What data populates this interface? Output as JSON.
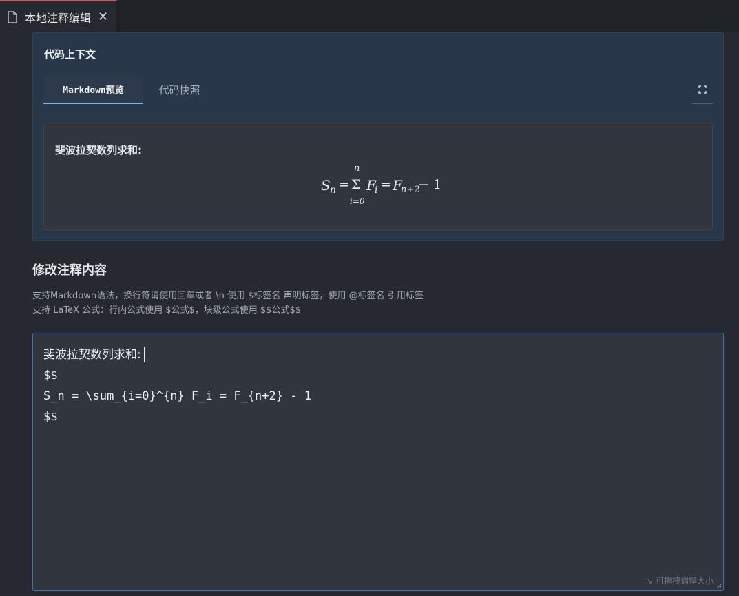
{
  "tab": {
    "label": "本地注释编辑",
    "icon": "document-icon",
    "close_icon": "close-icon"
  },
  "context": {
    "title": "代码上下文",
    "tabs": [
      {
        "label": "Markdown预览",
        "active": true
      },
      {
        "label": "代码快照",
        "active": false
      }
    ],
    "expand_icon": "expand-icon",
    "preview": {
      "text": "斐波拉契数列求和:",
      "formula": {
        "lhs": "S",
        "lhs_sub": "n",
        "sum_upper": "n",
        "sum_lower": "i=0",
        "sum_symbol": "Σ",
        "term": "F",
        "term_sub": "i",
        "rhs": "F",
        "rhs_sub": "n+2",
        "tail": "− 1"
      }
    }
  },
  "edit": {
    "title": "修改注释内容",
    "hint_line1": "支持Markdown语法，换行符请使用回车或者 \\n 使用 $标签名 声明标签，使用 @标签名 引用标签",
    "hint_line2": "支持 LaTeX 公式：行内公式使用 $公式$，块级公式使用 $$公式$$",
    "lines": [
      "斐波拉契数列求和:",
      "$$",
      "S_n = \\sum_{i=0}^{n} F_i = F_{n+2} - 1",
      "$$"
    ],
    "resize_hint": "↘ 可拖拽调整大小"
  },
  "colors": {
    "accent": "#3a73c4",
    "tab_indicator": "#7fb0e8",
    "card_bg": "#28374a"
  }
}
